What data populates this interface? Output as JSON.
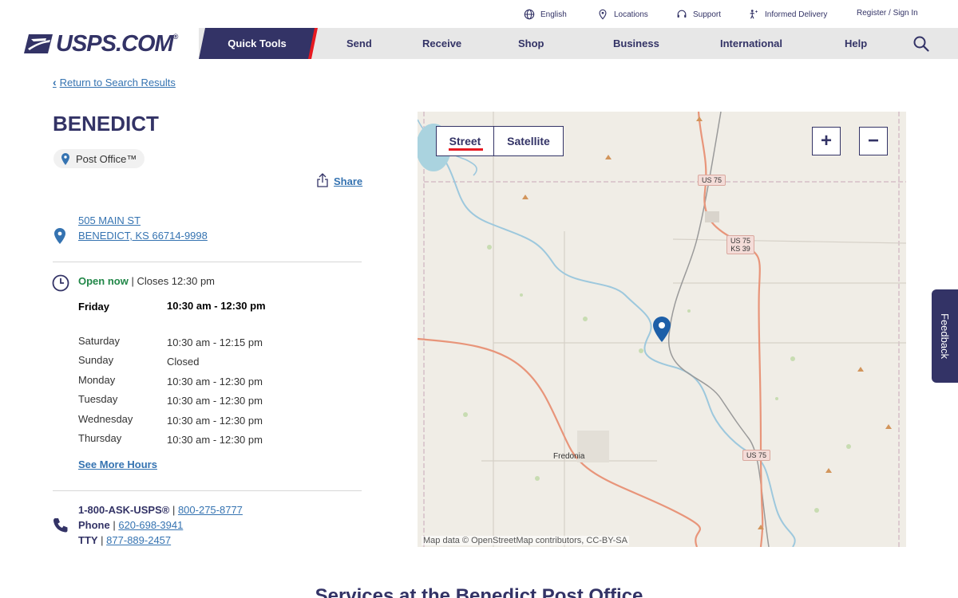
{
  "utility": {
    "language": "English",
    "locations": "Locations",
    "support": "Support",
    "informed_delivery": "Informed Delivery",
    "register": "Register / Sign In"
  },
  "logo": {
    "text": "USPS.COM",
    "mark": "®"
  },
  "nav": {
    "quick_tools": "Quick Tools",
    "send": "Send",
    "receive": "Receive",
    "shop": "Shop",
    "business": "Business",
    "international": "International",
    "help": "Help"
  },
  "page": {
    "back_link": "Return to Search Results",
    "title": "BENEDICT",
    "badge": "Post Office™",
    "share": "Share"
  },
  "address": {
    "line1": "505 MAIN ST",
    "line2": "BENEDICT, KS 66714-9998"
  },
  "status": {
    "open": "Open now",
    "separator": " | ",
    "closes": "Closes 12:30 pm"
  },
  "hours": [
    {
      "day": "Friday",
      "time": "10:30 am - 12:30 pm",
      "today": true
    },
    {
      "day": "Saturday",
      "time": "10:30 am - 12:15 pm",
      "today": false
    },
    {
      "day": "Sunday",
      "time": "Closed",
      "today": false
    },
    {
      "day": "Monday",
      "time": "10:30 am - 12:30 pm",
      "today": false
    },
    {
      "day": "Tuesday",
      "time": "10:30 am - 12:30 pm",
      "today": false
    },
    {
      "day": "Wednesday",
      "time": "10:30 am - 12:30 pm",
      "today": false
    },
    {
      "day": "Thursday",
      "time": "10:30 am - 12:30 pm",
      "today": false
    }
  ],
  "see_more_hours": "See More Hours",
  "contact": {
    "ask_label": "1-800-ASK-USPS®",
    "ask_number": "800-275-8777",
    "phone_label": "Phone",
    "phone_number": "620-698-3941",
    "tty_label": "TTY",
    "tty_number": "877-889-2457",
    "sep": " | "
  },
  "map": {
    "street": "Street",
    "satellite": "Satellite",
    "zoom_in": "+",
    "zoom_out": "−",
    "town_label": "Fredonia",
    "route_us75": "US 75",
    "route_ks39": "KS 39",
    "attribution": "Map data © OpenStreetMap contributors, CC-BY-SA"
  },
  "feedback": "Feedback",
  "services_heading": "Services at the Benedict Post Office",
  "colors": {
    "navy": "#333366",
    "red": "#e71921",
    "link": "#3573b1",
    "open_green": "#218748"
  }
}
